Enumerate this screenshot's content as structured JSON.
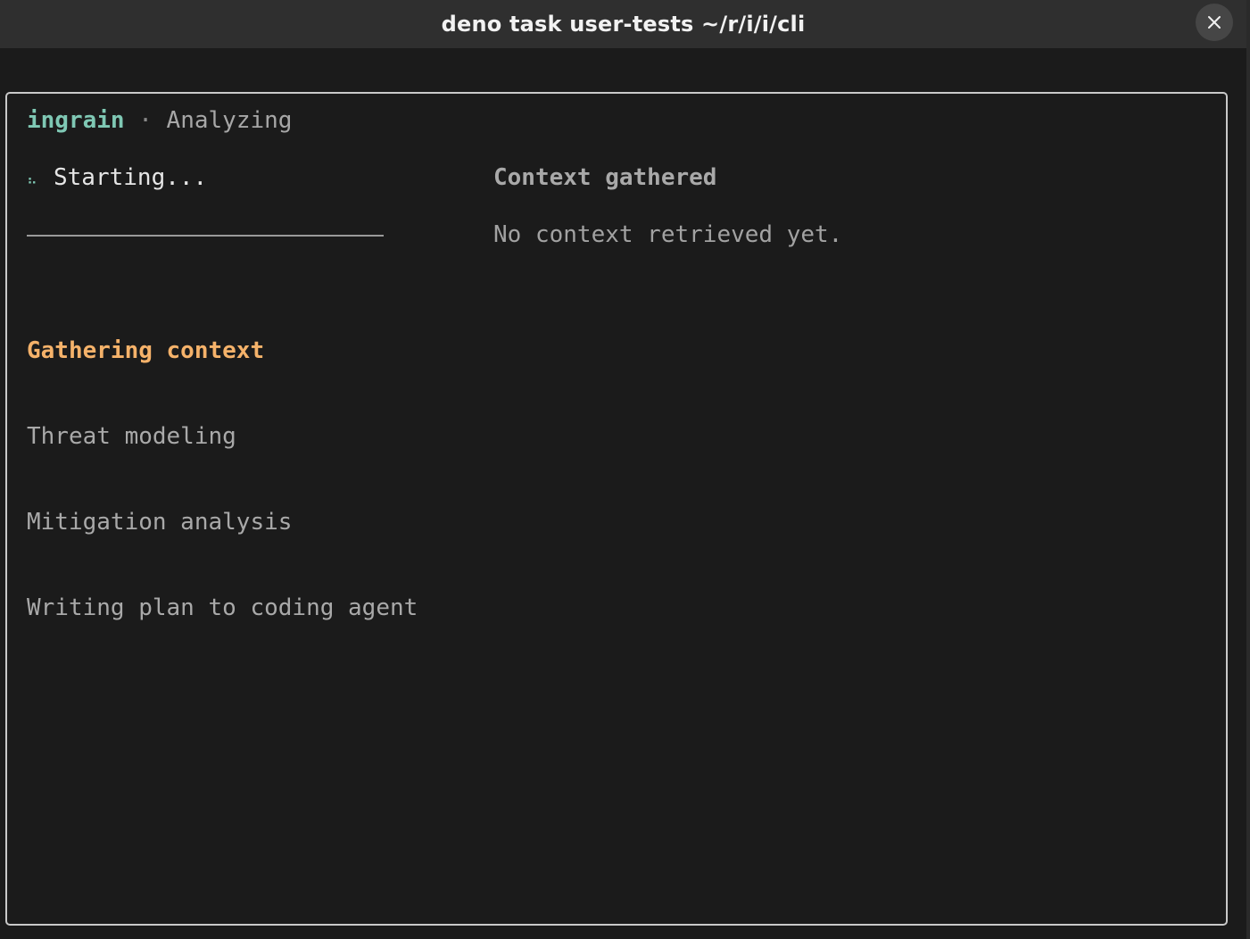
{
  "window": {
    "title": "deno task user-tests ~/r/i/i/cli"
  },
  "header": {
    "brand": "ingrain",
    "separator": "·",
    "status": "Analyzing"
  },
  "progress": {
    "spinner_glyph": "⠦",
    "message": "Starting..."
  },
  "steps": [
    {
      "label": "Gathering context",
      "state": "active"
    },
    {
      "label": "Threat modeling",
      "state": "pending"
    },
    {
      "label": "Mitigation analysis",
      "state": "pending"
    },
    {
      "label": "Writing plan to coding agent",
      "state": "pending"
    }
  ],
  "context": {
    "title": "Context gathered",
    "empty_message": "No context retrieved yet."
  },
  "colors": {
    "brand": "#7fc8b4",
    "active_step": "#f5b26a",
    "muted_text": "#a9a9a9",
    "background": "#1b1b1b"
  },
  "icons": {
    "close": "close-icon",
    "spinner": "spinner-icon"
  }
}
